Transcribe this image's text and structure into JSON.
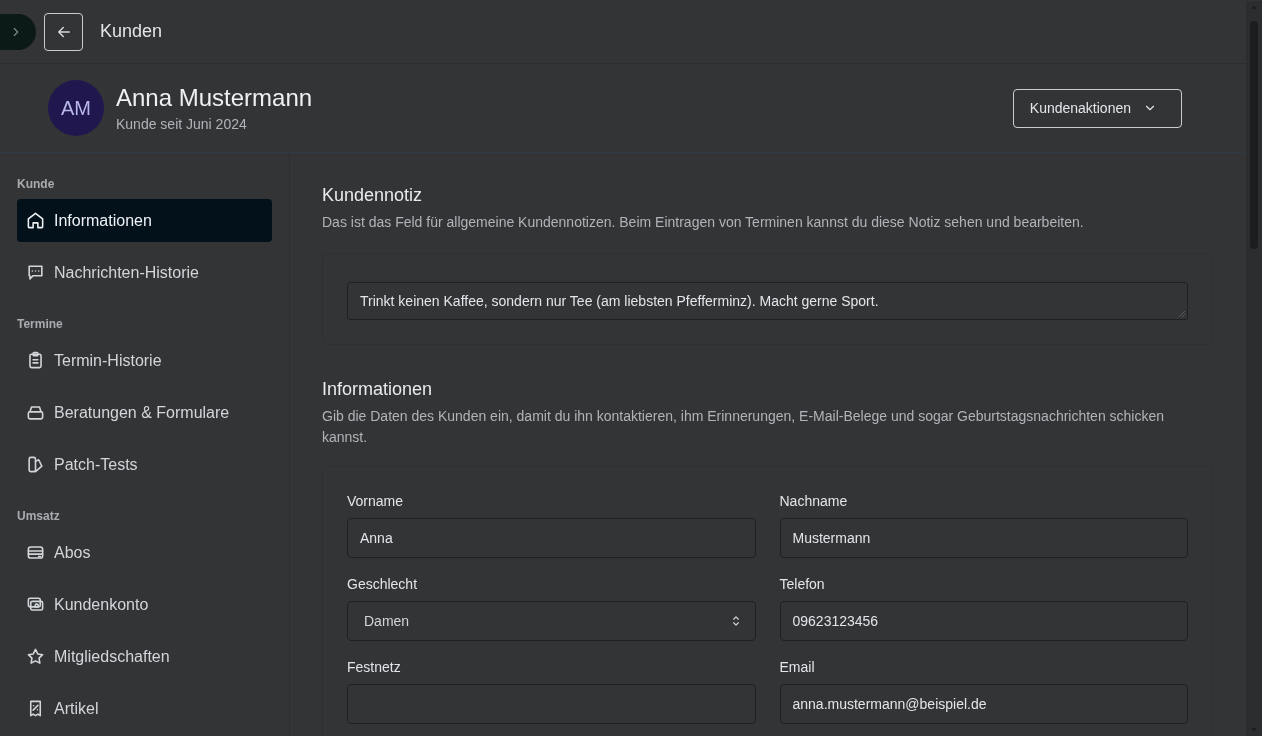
{
  "topbar": {
    "title": "Kunden"
  },
  "customer": {
    "initials": "AM",
    "name": "Anna Mustermann",
    "since": "Kunde seit Juni 2024",
    "actions_button": "Kundenaktionen"
  },
  "sidebar": {
    "sections": [
      {
        "title": "Kunde",
        "items": [
          {
            "label": "Informationen",
            "selected": true
          },
          {
            "label": "Nachrichten-Historie",
            "selected": false
          }
        ]
      },
      {
        "title": "Termine",
        "items": [
          {
            "label": "Termin-Historie",
            "selected": false
          },
          {
            "label": "Beratungen & Formulare",
            "selected": false
          },
          {
            "label": "Patch-Tests",
            "selected": false
          }
        ]
      },
      {
        "title": "Umsatz",
        "items": [
          {
            "label": "Abos",
            "selected": false
          },
          {
            "label": "Kundenkonto",
            "selected": false
          },
          {
            "label": "Mitgliedschaften",
            "selected": false
          },
          {
            "label": "Artikel",
            "selected": false
          }
        ]
      }
    ]
  },
  "note": {
    "title": "Kundennotiz",
    "description": "Das ist das Feld für allgemeine Kundennotizen. Beim Eintragen von Terminen kannst du diese Notiz sehen und bearbeiten.",
    "value": "Trinkt keinen Kaffee, sondern nur Tee (am liebsten Pfefferminz). Macht gerne Sport."
  },
  "info": {
    "title": "Informationen",
    "description": "Gib die Daten des Kunden ein, damit du ihn kontaktieren, ihm Erinnerungen, E-Mail-Belege und sogar Geburtstagsnachrichten schicken kannst.",
    "fields": [
      {
        "label": "Vorname",
        "kind": "text",
        "value": "Anna"
      },
      {
        "label": "Nachname",
        "kind": "text",
        "value": "Mustermann"
      },
      {
        "label": "Geschlecht",
        "kind": "select",
        "value": "Damen"
      },
      {
        "label": "Telefon",
        "kind": "text",
        "value": "09623123456"
      },
      {
        "label": "Festnetz",
        "kind": "text"
      },
      {
        "label": "Email",
        "kind": "text",
        "value": "anna.mustermann@beispiel.de"
      }
    ]
  }
}
